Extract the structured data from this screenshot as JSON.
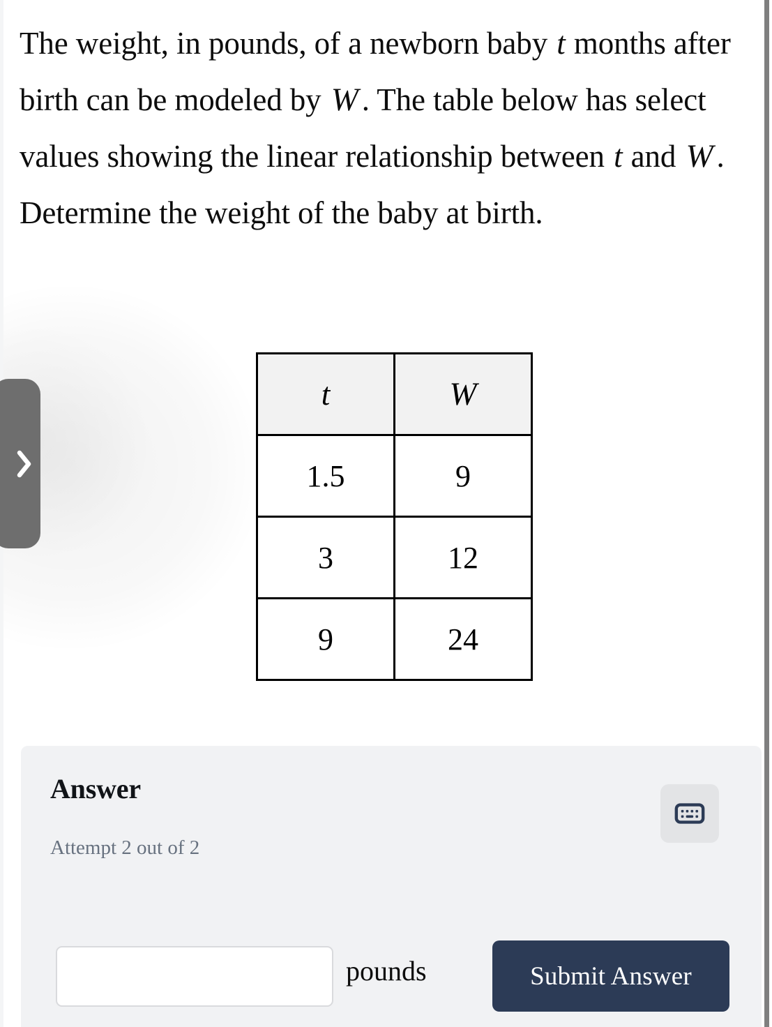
{
  "question": {
    "line1_a": "The weight, in pounds, of a newborn baby ",
    "var_t_1": "t",
    "line1_b": "months after birth can be modeled by ",
    "var_W_1": "W",
    "line1_c": ". The table below has select values showing the linear relationship between ",
    "var_t_2": "t",
    "line1_d": " and ",
    "var_W_2": "W",
    "line1_e": ". Determine the weight of the baby at birth."
  },
  "table": {
    "headers": [
      "t",
      "W"
    ],
    "rows": [
      [
        "1.5",
        "9"
      ],
      [
        "3",
        "12"
      ],
      [
        "9",
        "24"
      ]
    ]
  },
  "chart_data": {
    "type": "table",
    "title": "",
    "xlabel": "t",
    "ylabel": "W",
    "categories": [
      "1.5",
      "3",
      "9"
    ],
    "values": [
      9,
      12,
      24
    ],
    "series": [
      {
        "name": "W",
        "values": [
          9,
          12,
          24
        ]
      }
    ],
    "x": [
      1.5,
      3,
      9
    ]
  },
  "slide_tab": {
    "icon": "chevron-right-icon",
    "color": "#6e6e6e"
  },
  "answer": {
    "title": "Answer",
    "attempt_text": "Attempt 2 out of 2",
    "keyboard_button_icon": "keyboard-icon",
    "input_value": "",
    "input_placeholder": "",
    "unit_label": "pounds",
    "submit_label": "Submit Answer",
    "accent_color": "#2c3b56",
    "card_background": "#f1f2f4"
  }
}
